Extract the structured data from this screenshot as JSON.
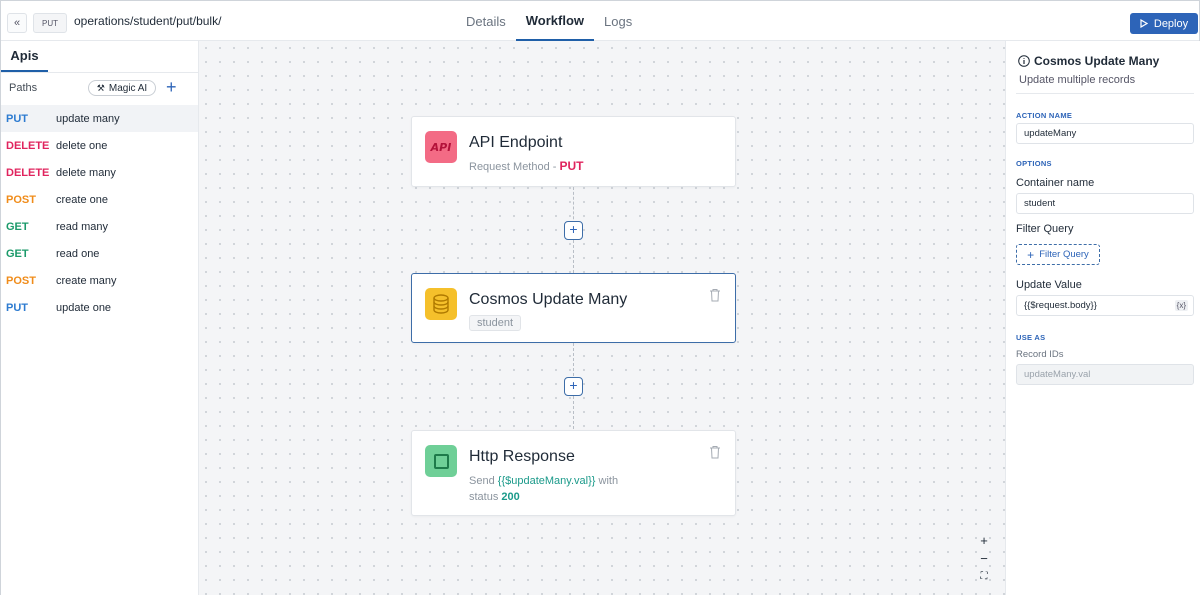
{
  "topbar": {
    "collapse_icon": "«",
    "method": "PUT",
    "path": "operations/student/put/bulk/",
    "tabs": [
      "Details",
      "Workflow",
      "Logs"
    ],
    "active_tab": "Workflow",
    "deploy_label": "Deploy"
  },
  "sidebar": {
    "tab_label": "Apis",
    "paths_label": "Paths",
    "magic_label": "Magic AI",
    "routes": [
      {
        "method": "PUT",
        "label": "update many",
        "color": "#2d7bd0"
      },
      {
        "method": "DELETE",
        "label": "delete one",
        "color": "#e0245e"
      },
      {
        "method": "DELETE",
        "label": "delete many",
        "color": "#e0245e"
      },
      {
        "method": "POST",
        "label": "create one",
        "color": "#f08c1a"
      },
      {
        "method": "GET",
        "label": "read many",
        "color": "#1b9a6a"
      },
      {
        "method": "GET",
        "label": "read one",
        "color": "#1b9a6a"
      },
      {
        "method": "POST",
        "label": "create many",
        "color": "#f08c1a"
      },
      {
        "method": "PUT",
        "label": "update one",
        "color": "#2d7bd0"
      }
    ]
  },
  "canvas": {
    "nodes": {
      "endpoint": {
        "title": "API Endpoint",
        "sub_prefix": "Request Method - ",
        "method": "PUT",
        "icon": "api-icon",
        "icon_text": "API"
      },
      "cosmos": {
        "title": "Cosmos Update Many",
        "tag": "student",
        "icon": "database-icon"
      },
      "response": {
        "title": "Http Response",
        "send": "Send",
        "var": "{{$updateMany.val}}",
        "with": "with",
        "status_label": "status",
        "status": "200",
        "icon": "response-icon"
      }
    },
    "zoom": {
      "in": "+",
      "out": "−",
      "fit": "⛶"
    }
  },
  "panel": {
    "title": "Cosmos Update Many",
    "subtitle": "Update multiple records",
    "action_name_label": "ACTION NAME",
    "action_name": "updateMany",
    "options_label": "OPTIONS",
    "container_label": "Container name",
    "container_value": "student",
    "filter_label": "Filter Query",
    "filter_button": "Filter Query",
    "update_label": "Update Value",
    "update_value": "{{$request.body}}",
    "var_icon": "{x}",
    "use_as_label": "USE AS",
    "record_ids_label": "Record IDs",
    "record_ids_value": "updateMany.val"
  },
  "colors": {
    "accent": "#2d64b8",
    "put": "#2d7bd0",
    "delete": "#e0245e",
    "post": "#f08c1a",
    "get": "#1b9a6a"
  }
}
